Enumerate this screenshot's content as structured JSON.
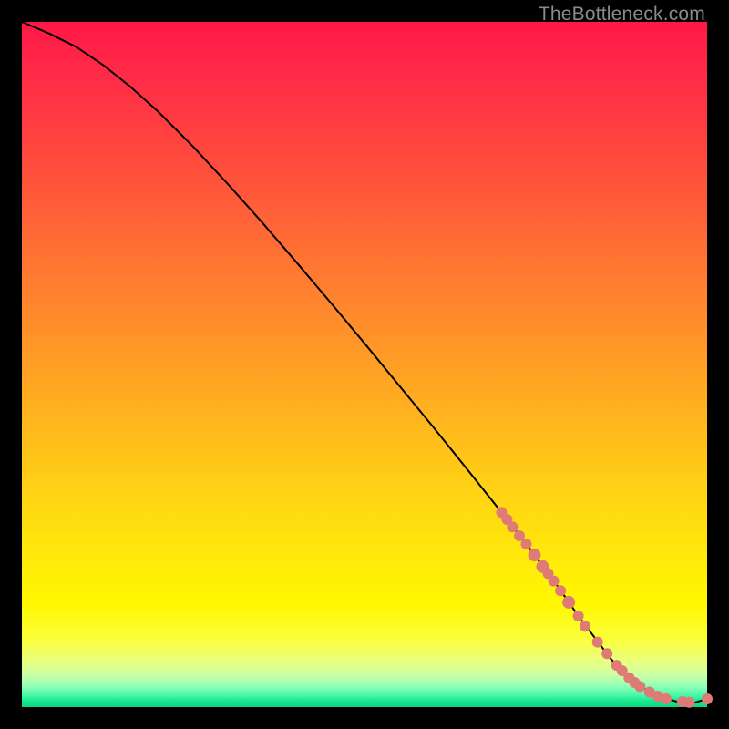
{
  "watermark": "TheBottleneck.com",
  "colors": {
    "curve_stroke": "#000000",
    "marker_fill": "#e07a76",
    "marker_stroke": "#d96b67"
  },
  "chart_data": {
    "type": "line",
    "title": "",
    "xlabel": "",
    "ylabel": "",
    "xlim": [
      0,
      100
    ],
    "ylim": [
      0,
      100
    ],
    "series": [
      {
        "name": "curve",
        "kind": "line",
        "x": [
          0,
          4,
          8,
          12,
          16,
          20,
          25,
          30,
          35,
          40,
          45,
          50,
          55,
          60,
          65,
          70,
          74,
          78,
          81,
          84,
          86,
          88,
          90,
          92,
          94,
          96,
          98,
          100
        ],
        "y": [
          100,
          98.3,
          96.3,
          93.6,
          90.4,
          86.8,
          81.8,
          76.4,
          70.8,
          65.0,
          59.1,
          53.1,
          47.0,
          40.9,
          34.7,
          28.4,
          23.3,
          17.9,
          13.6,
          9.6,
          7.0,
          4.9,
          3.2,
          2.0,
          1.2,
          0.7,
          0.6,
          1.2
        ]
      },
      {
        "name": "markers",
        "kind": "scatter",
        "points": [
          {
            "x": 70.0,
            "y": 28.4,
            "r": 6
          },
          {
            "x": 70.8,
            "y": 27.4,
            "r": 6
          },
          {
            "x": 71.6,
            "y": 26.3,
            "r": 6
          },
          {
            "x": 72.6,
            "y": 25.0,
            "r": 6
          },
          {
            "x": 73.6,
            "y": 23.8,
            "r": 6
          },
          {
            "x": 74.8,
            "y": 22.2,
            "r": 7
          },
          {
            "x": 76.0,
            "y": 20.5,
            "r": 7
          },
          {
            "x": 76.8,
            "y": 19.5,
            "r": 6
          },
          {
            "x": 77.6,
            "y": 18.4,
            "r": 6
          },
          {
            "x": 78.6,
            "y": 17.0,
            "r": 6
          },
          {
            "x": 79.8,
            "y": 15.3,
            "r": 7
          },
          {
            "x": 81.2,
            "y": 13.3,
            "r": 6
          },
          {
            "x": 82.2,
            "y": 11.8,
            "r": 6
          },
          {
            "x": 84.0,
            "y": 9.5,
            "r": 6
          },
          {
            "x": 85.4,
            "y": 7.8,
            "r": 6
          },
          {
            "x": 86.8,
            "y": 6.1,
            "r": 6
          },
          {
            "x": 87.6,
            "y": 5.3,
            "r": 6
          },
          {
            "x": 88.6,
            "y": 4.3,
            "r": 6
          },
          {
            "x": 89.4,
            "y": 3.6,
            "r": 6
          },
          {
            "x": 90.2,
            "y": 3.0,
            "r": 6
          },
          {
            "x": 91.6,
            "y": 2.2,
            "r": 6
          },
          {
            "x": 92.8,
            "y": 1.6,
            "r": 6
          },
          {
            "x": 94.0,
            "y": 1.2,
            "r": 6
          },
          {
            "x": 96.4,
            "y": 0.8,
            "r": 6
          },
          {
            "x": 97.4,
            "y": 0.7,
            "r": 6
          },
          {
            "x": 100.0,
            "y": 1.2,
            "r": 6
          }
        ]
      }
    ]
  }
}
